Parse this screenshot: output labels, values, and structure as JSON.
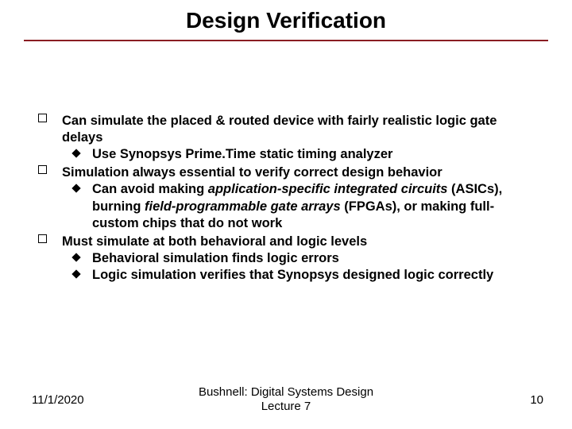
{
  "title": "Design Verification",
  "items": [
    {
      "text": "Can simulate the placed & routed device with fairly realistic logic gate delays",
      "subs": [
        {
          "text": "Use Synopsys Prime.Time static timing analyzer"
        }
      ]
    },
    {
      "text": "Simulation always essential to verify correct design behavior",
      "subs": [
        {
          "pre": "Can avoid making ",
          "ital1": "application-specific integrated circuits",
          "mid": " (ASICs), burning ",
          "ital2": "field-programmable gate arrays",
          "post": " (FPGAs), or making full-custom chips that do not work"
        }
      ]
    },
    {
      "text": "Must simulate at both behavioral and logic levels",
      "subs": [
        {
          "text": "Behavioral simulation finds logic errors"
        },
        {
          "text": "Logic simulation verifies that Synopsys designed logic correctly"
        }
      ]
    }
  ],
  "footer": {
    "date": "11/1/2020",
    "center1": "Bushnell: Digital Systems Design",
    "center2": "Lecture 7",
    "page": "10"
  }
}
